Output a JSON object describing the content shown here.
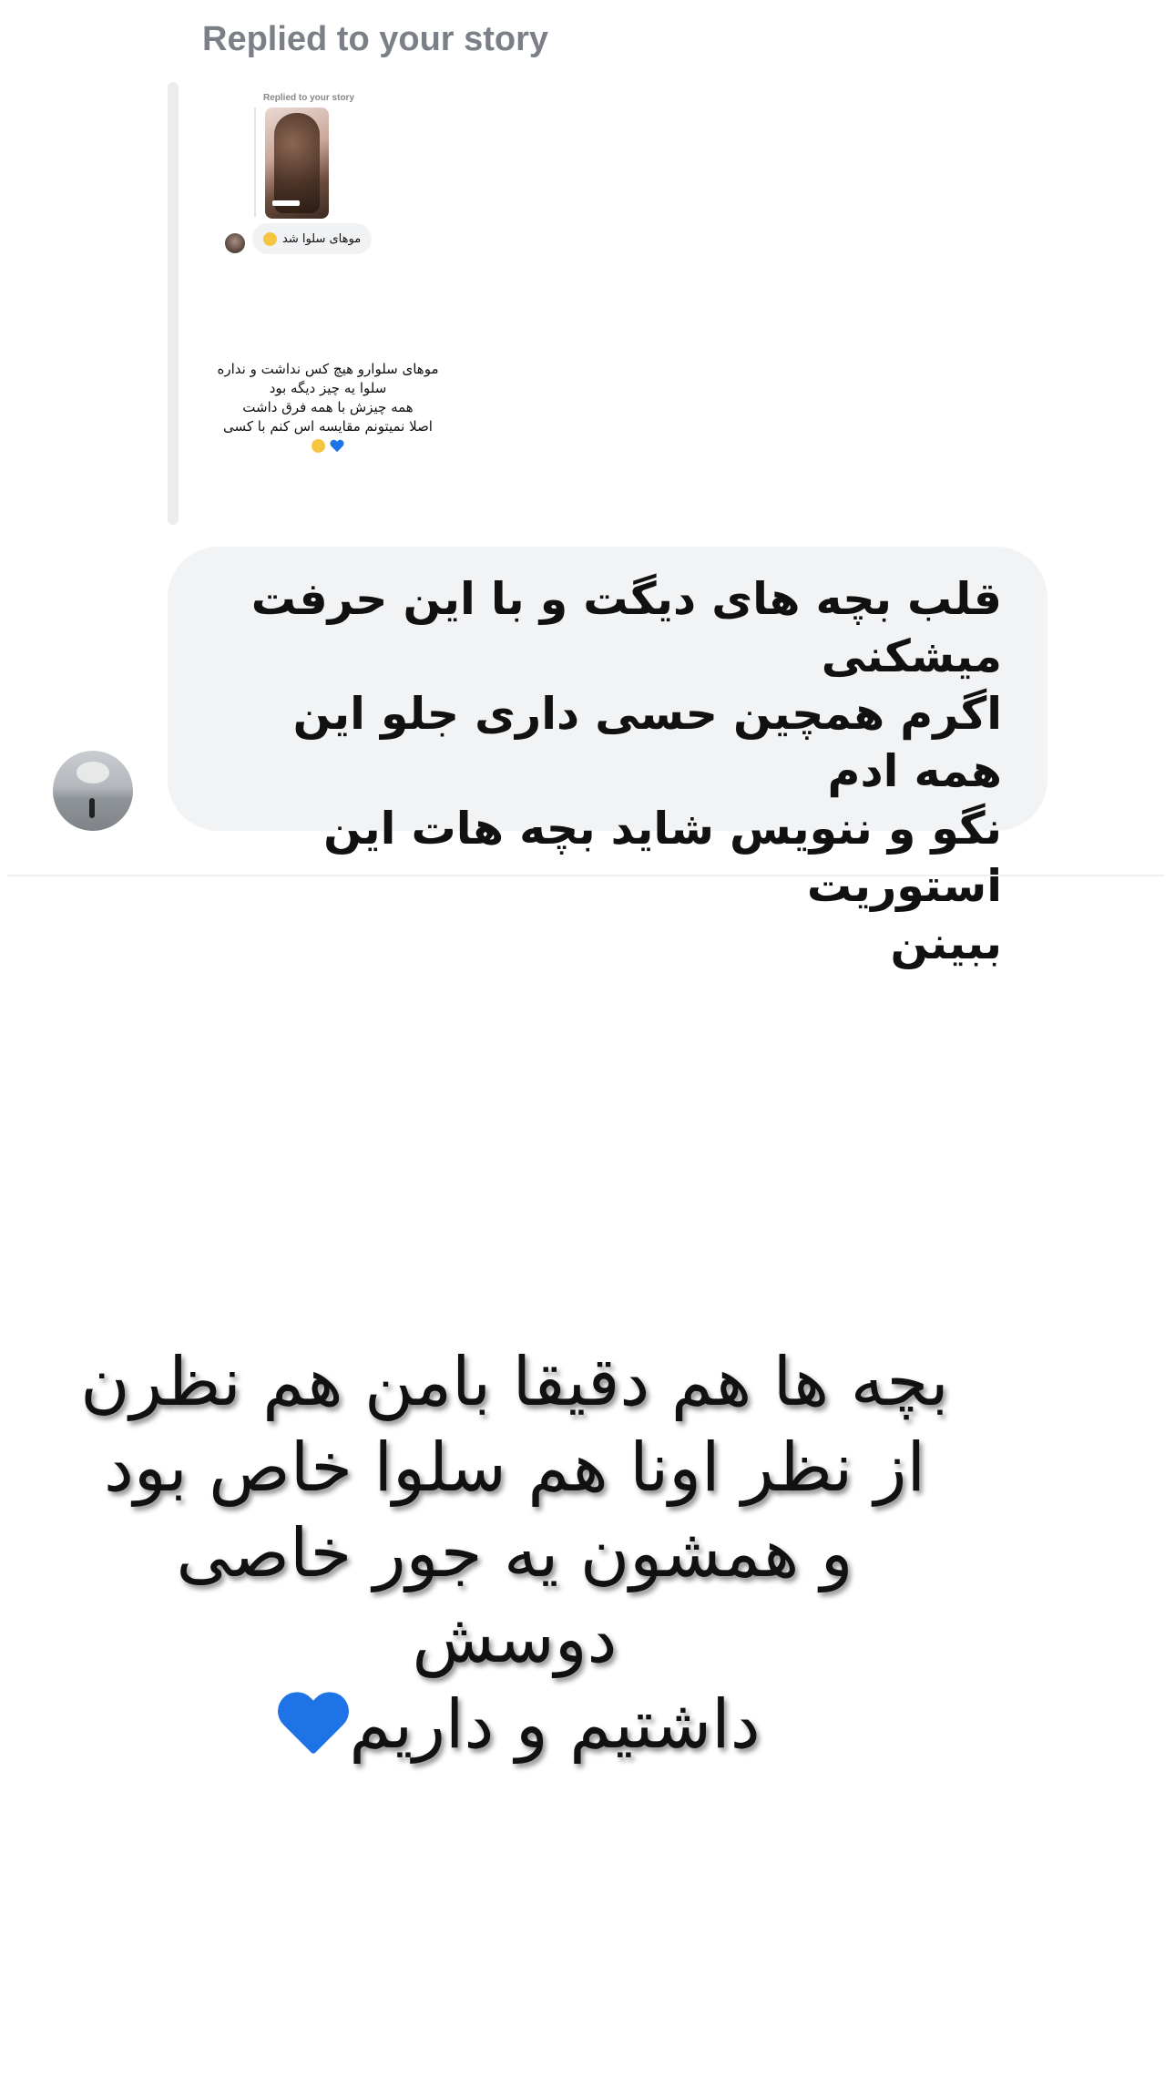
{
  "thread": {
    "replied_header": "Replied to your story",
    "story_preview": {
      "mini_replied_label": "Replied to your story",
      "mini_bubble_text": "موهای سلوا شد",
      "caption_lines": [
        "موهای سلوارو هیچ کس نداشت و نداره",
        "سلوا یه چیز دیگه بود",
        "همه چیزش با همه فرق داشت",
        "اصلا نمیتونم مقایسه اس کنم با کسی"
      ]
    },
    "reply_message": "قلب بچه های دیگت و با این حرفت میشکنی\nاگرم همچین حسی داری جلو این همه ادم\nنگو و ننویس  شاید بچه هات این استوریت\nببینن"
  },
  "story_overlay_text": "بچه ها هم دقیقا بامن هم نظرن\nاز نظر اونا هم سلوا  خاص بود\nو همشون یه جور خاصی دوسش\nداشتیم و داریم",
  "colors": {
    "bubble_bg": "#f2f3f5",
    "header_gray": "#7b7f87",
    "heart_blue": "#1e73e6"
  },
  "icons": [
    "blue-heart-icon",
    "face-emoji-icon"
  ]
}
